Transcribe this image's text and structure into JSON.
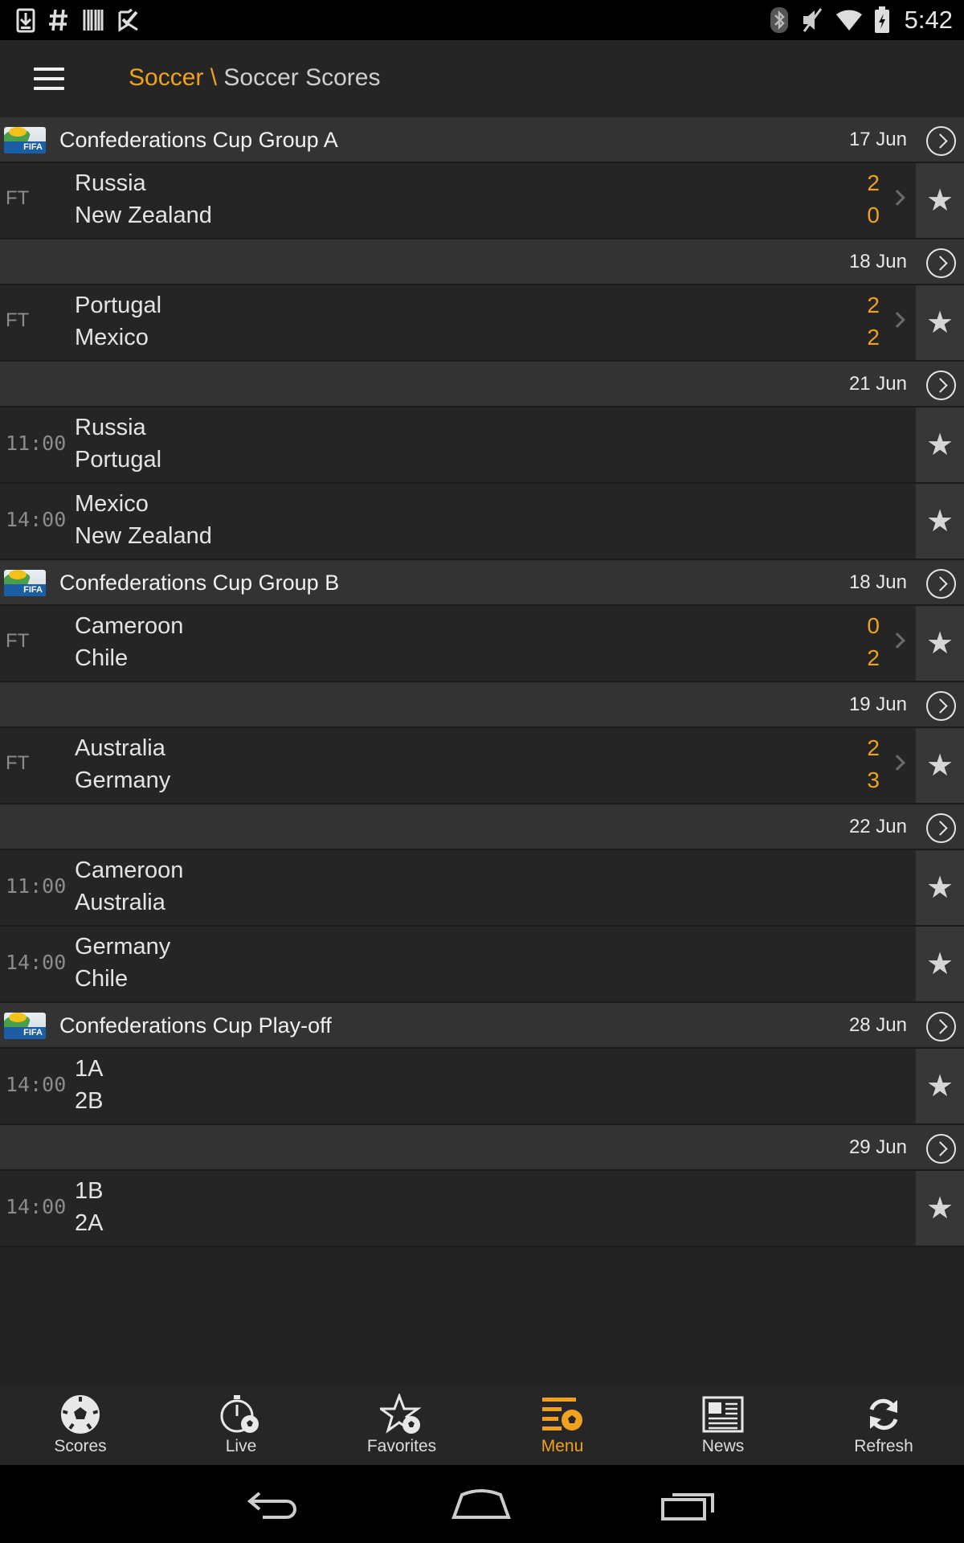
{
  "status_bar": {
    "time": "5:42",
    "left_icons": [
      "download-icon",
      "hash-icon",
      "barcode-icon",
      "checkmark-icon"
    ],
    "right_icons": [
      "bluetooth-icon",
      "mute-icon",
      "wifi-icon",
      "battery-icon"
    ]
  },
  "header": {
    "breadcrumb_root": "Soccer",
    "breadcrumb_sep": "\\",
    "breadcrumb_current": "Soccer Scores"
  },
  "rows": [
    {
      "kind": "group",
      "title": "Confederations Cup Group A",
      "date": "17 Jun",
      "flag": true
    },
    {
      "kind": "match",
      "time": "FT",
      "home": "Russia",
      "away": "New Zealand",
      "home_score": "2",
      "away_score": "0",
      "finished": true
    },
    {
      "kind": "group",
      "title": "",
      "date": "18 Jun",
      "flag": false
    },
    {
      "kind": "match",
      "time": "FT",
      "home": "Portugal",
      "away": "Mexico",
      "home_score": "2",
      "away_score": "2",
      "finished": true
    },
    {
      "kind": "group",
      "title": "",
      "date": "21 Jun",
      "flag": false
    },
    {
      "kind": "match",
      "time": "11:00",
      "home": "Russia",
      "away": "Portugal",
      "home_score": "",
      "away_score": "",
      "finished": false
    },
    {
      "kind": "match",
      "time": "14:00",
      "home": "Mexico",
      "away": "New Zealand",
      "home_score": "",
      "away_score": "",
      "finished": false
    },
    {
      "kind": "group",
      "title": "Confederations Cup Group B",
      "date": "18 Jun",
      "flag": true
    },
    {
      "kind": "match",
      "time": "FT",
      "home": "Cameroon",
      "away": "Chile",
      "home_score": "0",
      "away_score": "2",
      "finished": true
    },
    {
      "kind": "group",
      "title": "",
      "date": "19 Jun",
      "flag": false
    },
    {
      "kind": "match",
      "time": "FT",
      "home": "Australia",
      "away": "Germany",
      "home_score": "2",
      "away_score": "3",
      "finished": true
    },
    {
      "kind": "group",
      "title": "",
      "date": "22 Jun",
      "flag": false
    },
    {
      "kind": "match",
      "time": "11:00",
      "home": "Cameroon",
      "away": "Australia",
      "home_score": "",
      "away_score": "",
      "finished": false
    },
    {
      "kind": "match",
      "time": "14:00",
      "home": "Germany",
      "away": "Chile",
      "home_score": "",
      "away_score": "",
      "finished": false
    },
    {
      "kind": "group",
      "title": "Confederations Cup Play-off",
      "date": "28 Jun",
      "flag": true
    },
    {
      "kind": "match",
      "time": "14:00",
      "home": "1A",
      "away": "2B",
      "home_score": "",
      "away_score": "",
      "finished": false
    },
    {
      "kind": "group",
      "title": "",
      "date": "29 Jun",
      "flag": false
    },
    {
      "kind": "match",
      "time": "14:00",
      "home": "1B",
      "away": "2A",
      "home_score": "",
      "away_score": "",
      "finished": false
    }
  ],
  "flag_label": "FIFA",
  "bottom_nav": {
    "items": [
      {
        "label": "Scores",
        "icon": "soccer-ball-icon",
        "active": false
      },
      {
        "label": "Live",
        "icon": "stopwatch-ball-icon",
        "active": false
      },
      {
        "label": "Favorites",
        "icon": "star-ball-icon",
        "active": false
      },
      {
        "label": "Menu",
        "icon": "menu-ball-icon",
        "active": true
      },
      {
        "label": "News",
        "icon": "newspaper-icon",
        "active": false
      },
      {
        "label": "Refresh",
        "icon": "refresh-icon",
        "active": false
      }
    ]
  },
  "colors": {
    "accent": "#f0a21c",
    "background": "#232323",
    "group_row": "#333333",
    "star_cell": "#363636"
  }
}
